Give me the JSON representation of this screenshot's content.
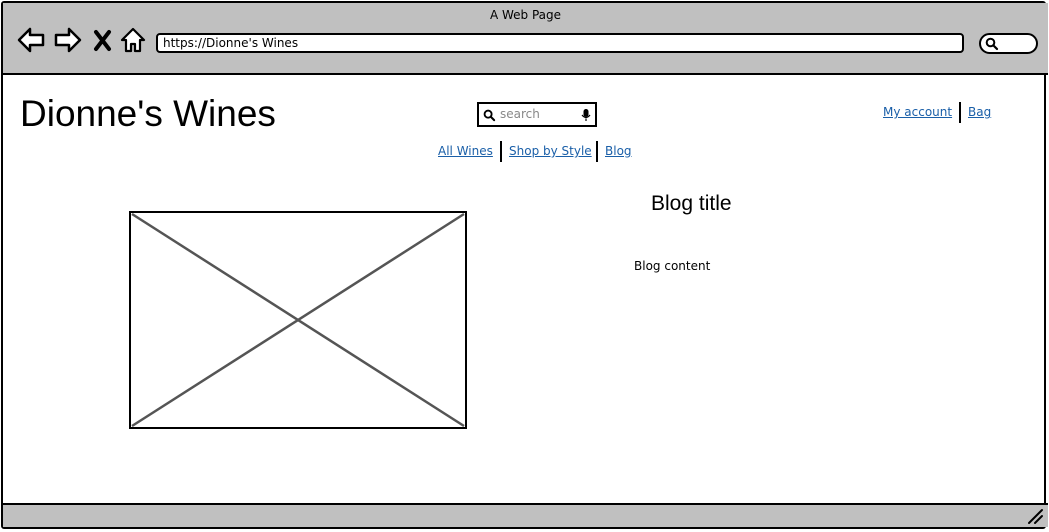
{
  "browser": {
    "window_title": "A Web Page",
    "url": "https://Dionne's Wines",
    "icons": [
      "back-arrow-icon",
      "forward-arrow-icon",
      "close-x-icon",
      "home-icon",
      "search-icon"
    ]
  },
  "header": {
    "site_title": "Dionne's Wines",
    "search_placeholder": "search",
    "account_links": [
      "My account",
      "Bag"
    ]
  },
  "nav": {
    "items": [
      "All Wines",
      "Shop by Style",
      "Blog"
    ]
  },
  "main": {
    "blog_title": "Blog title",
    "blog_content": "Blog content",
    "image_placeholder": "image-placeholder"
  },
  "colors": {
    "chrome": "#c0c0c0",
    "link": "#1a5fa8"
  }
}
